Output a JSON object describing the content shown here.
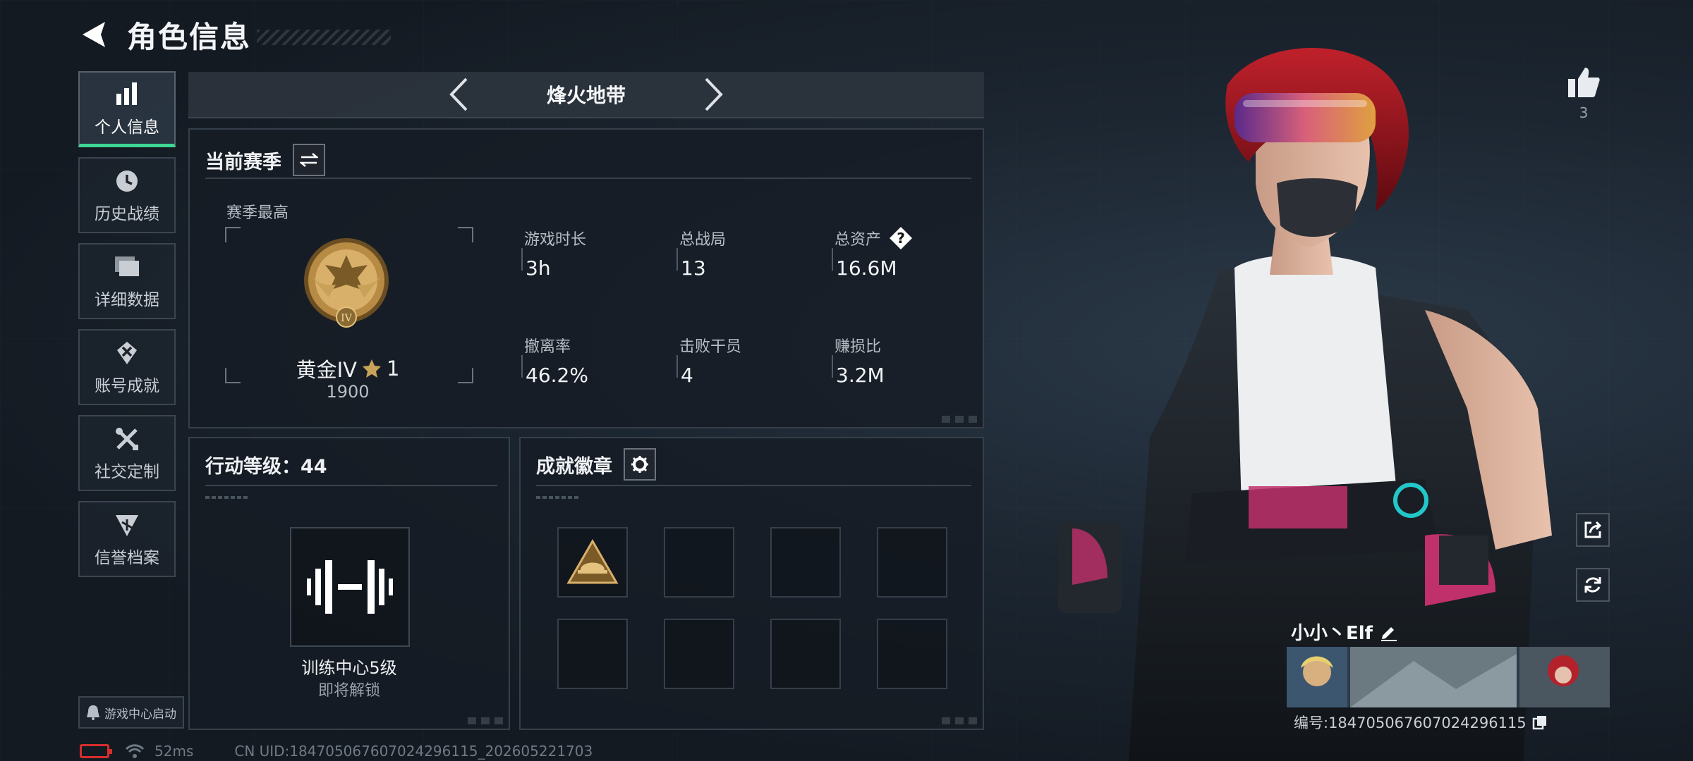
{
  "header": {
    "title": "角色信息"
  },
  "sidebar": {
    "items": [
      {
        "label": "个人信息",
        "icon": "bar-chart-icon",
        "active": true
      },
      {
        "label": "历史战绩",
        "icon": "history-icon",
        "active": false
      },
      {
        "label": "详细数据",
        "icon": "folder-icon",
        "active": false
      },
      {
        "label": "账号成就",
        "icon": "achievement-icon",
        "active": false
      },
      {
        "label": "社交定制",
        "icon": "tools-icon",
        "active": false
      },
      {
        "label": "信誉档案",
        "icon": "credibility-icon",
        "active": false
      }
    ],
    "launch_label": "游戏中心启动"
  },
  "status": {
    "latency": "52ms",
    "uid": "CN UID:184705067607024296115_202605221703"
  },
  "mode": {
    "title": "烽火地带"
  },
  "season": {
    "title": "当前赛季",
    "subtitle": "赛季最高",
    "rank_name": "黄金IV",
    "rank_stars": "1",
    "rank_score": "1900",
    "rank_numeral": "IV",
    "stats": [
      {
        "label": "游戏时长",
        "value": "3h"
      },
      {
        "label": "总战局",
        "value": "13"
      },
      {
        "label": "总资产",
        "value": "16.6M"
      },
      {
        "label": "撤离率",
        "value": "46.2%"
      },
      {
        "label": "击败干员",
        "value": "4"
      },
      {
        "label": "赚损比",
        "value": "3.2M"
      }
    ]
  },
  "level": {
    "title": "行动等级：44",
    "facility_name": "训练中心5级",
    "facility_status": "即将解锁"
  },
  "badges": {
    "title": "成就徽章"
  },
  "profile": {
    "likes": "3",
    "name": "小小丶Elf",
    "id_text": "编号:184705067607024296115"
  },
  "colors": {
    "accent_green": "#3fd693",
    "gold": "#c9a25a",
    "red_hair": "#a3121b"
  }
}
